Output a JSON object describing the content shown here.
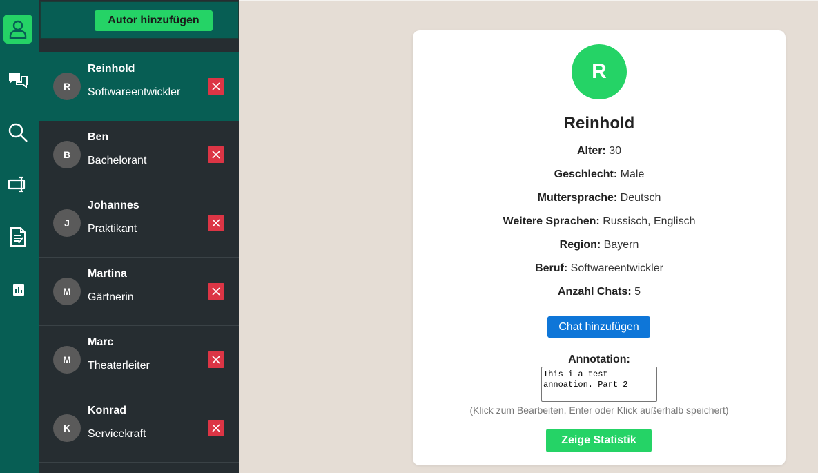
{
  "rail": {
    "items": [
      {
        "icon": "user-icon",
        "active": true
      },
      {
        "icon": "chat-icon"
      },
      {
        "icon": "search-icon"
      },
      {
        "icon": "device-icon"
      },
      {
        "icon": "document-icon"
      },
      {
        "icon": "bar-chart-icon"
      }
    ]
  },
  "list": {
    "add_label": "Autor hinzufügen",
    "authors": [
      {
        "initial": "R",
        "name": "Reinhold",
        "role": "Softwareentwickler"
      },
      {
        "initial": "B",
        "name": "Ben",
        "role": "Bachelorant"
      },
      {
        "initial": "J",
        "name": "Johannes",
        "role": "Praktikant"
      },
      {
        "initial": "M",
        "name": "Martina",
        "role": "Gärtnerin"
      },
      {
        "initial": "M",
        "name": "Marc",
        "role": "Theaterleiter"
      },
      {
        "initial": "K",
        "name": "Konrad",
        "role": "Servicekraft"
      }
    ]
  },
  "profile": {
    "initial": "R",
    "name": "Reinhold",
    "fields": [
      {
        "label": "Alter:",
        "value": "30"
      },
      {
        "label": "Geschlecht:",
        "value": "Male"
      },
      {
        "label": "Muttersprache:",
        "value": "Deutsch"
      },
      {
        "label": "Weitere Sprachen:",
        "value": "Russisch, Englisch"
      },
      {
        "label": "Region:",
        "value": "Bayern"
      },
      {
        "label": "Beruf:",
        "value": "Softwareentwickler"
      },
      {
        "label": "Anzahl Chats:",
        "value": "5"
      }
    ],
    "add_chat_label": "Chat hinzufügen",
    "annotation_label": "Annotation:",
    "annotation_value": "This i a test annoation. Part 2",
    "hint": "(Klick zum Bearbeiten, Enter oder Klick außerhalb speichert)",
    "stats_label": "Zeige Statistik"
  },
  "colors": {
    "primary_dark": "#075e54",
    "accent": "#25d366",
    "danger": "#dc3545",
    "blue": "#0e76d8",
    "list_bg": "#262d31",
    "main_bg": "#e5ddd5"
  }
}
